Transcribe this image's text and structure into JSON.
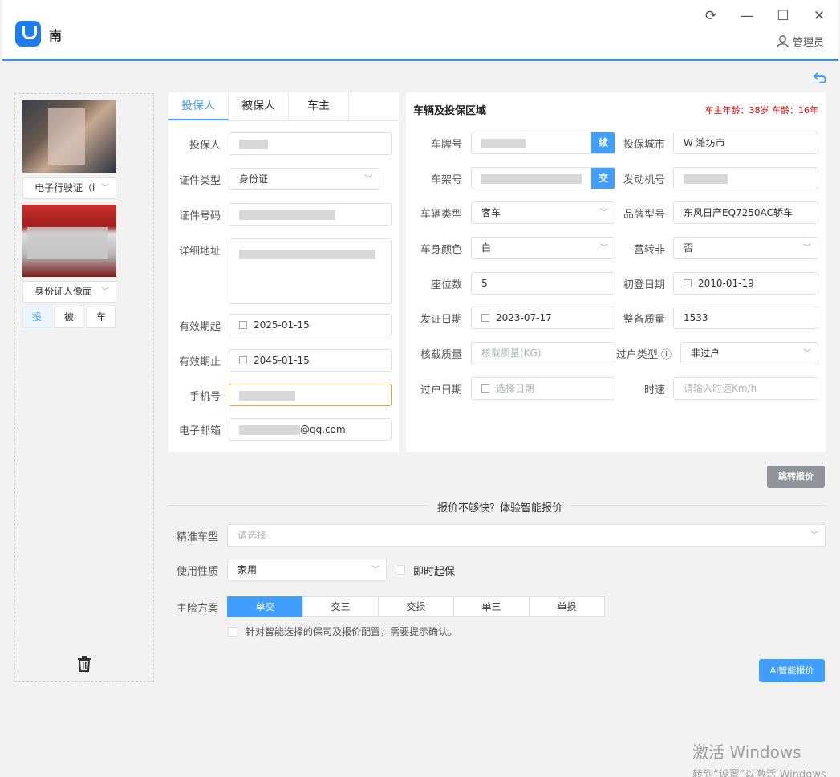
{
  "app": {
    "title": "南",
    "user": "管理员"
  },
  "sidebar": {
    "doc_type_1": "电子行驶证（i",
    "doc_type_2": "身份证人像面",
    "roles": [
      "投",
      "被",
      "车"
    ]
  },
  "left_card": {
    "tabs": [
      "投保人",
      "被保人",
      "车主"
    ],
    "fields": {
      "policyholder_label": "投保人",
      "id_type_label": "证件类型",
      "id_type_value": "身份证",
      "id_number_label": "证件号码",
      "address_label": "详细地址",
      "valid_from_label": "有效期起",
      "valid_from_value": "2025-01-15",
      "valid_to_label": "有效期止",
      "valid_to_value": "2045-01-15",
      "phone_label": "手机号",
      "email_label": "电子邮箱",
      "email_value": "@qq.com"
    }
  },
  "right_card": {
    "title": "车辆及投保区域",
    "age_info": "车主年龄：38岁 车龄：16年",
    "fields": {
      "plate_label": "车牌号",
      "plate_addon": "续",
      "city_label": "投保城市",
      "city_value": "W 潍坊市",
      "vin_label": "车架号",
      "vin_addon": "交",
      "engine_label": "发动机号",
      "vehicle_type_label": "车辆类型",
      "vehicle_type_value": "客车",
      "brand_label": "品牌型号",
      "brand_value": "东风日产EQ7250AC轿车",
      "color_label": "车身颜色",
      "color_value": "白",
      "commercial_label": "营转非",
      "commercial_value": "否",
      "seats_label": "座位数",
      "seats_value": "5",
      "reg_date_label": "初登日期",
      "reg_date_value": "2010-01-19",
      "issue_date_label": "发证日期",
      "issue_date_value": "2023-07-17",
      "weight_label": "整备质量",
      "weight_value": "1533",
      "load_label": "核载质量",
      "load_placeholder": "核载质量(KG)",
      "transfer_type_label": "过户类型",
      "transfer_type_value": "非过户",
      "transfer_date_label": "过户日期",
      "transfer_date_placeholder": "选择日期",
      "speed_label": "时速",
      "speed_placeholder": "请输入时速Km/h"
    }
  },
  "jump_button": "跳转报价",
  "smart": {
    "divider": "报价不够快？体验智能报价",
    "model_label": "精准车型",
    "model_placeholder": "请选择",
    "usage_label": "使用性质",
    "usage_value": "家用",
    "immediate_label": "即时起保",
    "plan_label": "主险方案",
    "plans": [
      "单交",
      "交三",
      "交损",
      "单三",
      "单损"
    ],
    "confirm_text": "针对智能选择的保司及报价配置，需要提示确认。",
    "ai_button": "AI智能报价"
  },
  "watermark": {
    "line1": "激活 Windows",
    "line2": "转到“设置”以激活 Windows"
  },
  "colors": {
    "primary": "#409eff",
    "titlebar_border": "#3f8ee6",
    "warning_text": "#dd0000"
  }
}
